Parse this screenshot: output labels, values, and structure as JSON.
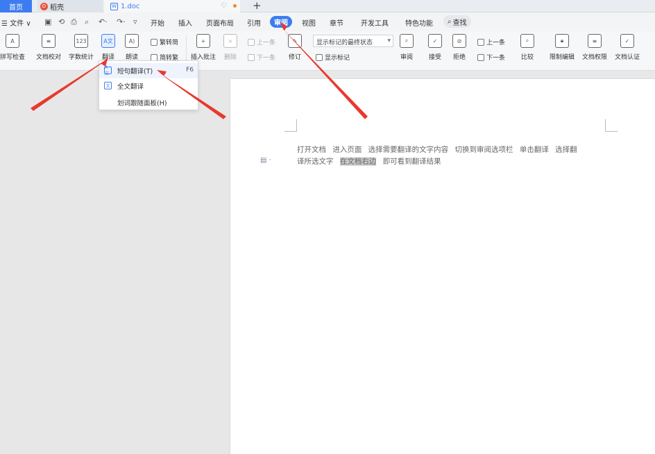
{
  "tabs": {
    "home": "首页",
    "daoke": "稻壳",
    "daoke_logo": "D",
    "doc": "1.doc",
    "doc_icon": "W",
    "new_tab": "+"
  },
  "menu": {
    "file": "☰ 文件 ∨",
    "items": [
      "开始",
      "插入",
      "页面布局",
      "引用",
      "审阅",
      "视图",
      "章节",
      "开发工具",
      "特色功能"
    ],
    "search": "查找"
  },
  "ribbon": {
    "spellcheck": "拼写检查",
    "proofread": "文档校对",
    "wordcount": "字数统计",
    "translate": "翻译",
    "read_aloud": "朗读",
    "trad_simp": "繁转简",
    "simp_trad": "简转繁",
    "insert_comment": "插入批注",
    "delete": "删除",
    "prev_comment": "上一条",
    "next_comment": "下一条",
    "revise": "修订",
    "markup_state": "显示标记的最终状态",
    "show_markup": "显示标记",
    "review": "审阅",
    "accept": "接受",
    "reject": "拒绝",
    "prev": "上一条",
    "next": "下一条",
    "compare": "比较",
    "restrict_edit": "限制编辑",
    "doc_permission": "文档权限",
    "doc_cert": "文档认证"
  },
  "dropdown": {
    "sentence": "短句翻译(T)",
    "sentence_key": "F6",
    "full": "全文翻译",
    "panel": "划词跟随面板(H)"
  },
  "document": {
    "line1": "打开文档 进入页面 选择需要翻译的文字内容 切换到审阅选项栏 单击翻译 选择翻",
    "line2a": "译所选文字",
    "line2_hl": "在文档右边",
    "line2b": "即可看到翻译结果"
  },
  "colors": {
    "accent": "#3d7cf0",
    "arrow": "#e8392e"
  }
}
